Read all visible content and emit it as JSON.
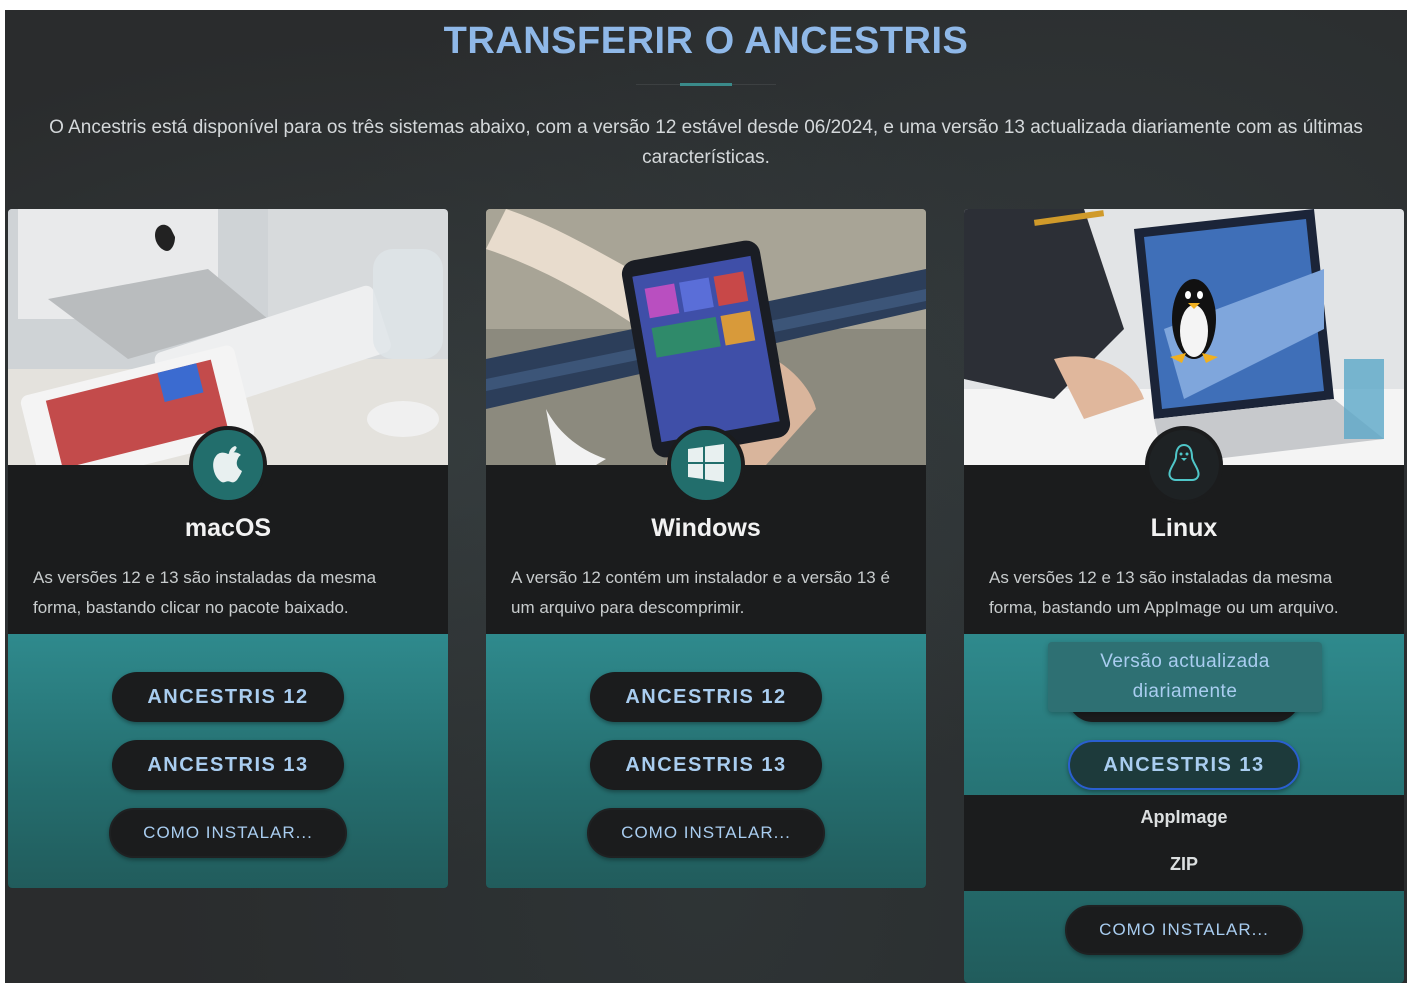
{
  "header": {
    "title": "TRANSFERIR O ANCESTRIS",
    "intro": "O Ancestris está disponível para os três sistemas abaixo, com a versão 12 estável desde 06/2024, e uma versão 13 actualizada diariamente com as últimas características."
  },
  "cards": [
    {
      "name": "macOS",
      "icon": "apple-icon",
      "description": "As versões 12 e 13 são instaladas da mesma forma, bastando clicar no pacote baixado.",
      "button_v12": "ANCESTRIS 12",
      "button_v13": "ANCESTRIS 13",
      "button_howto": "COMO INSTALAR..."
    },
    {
      "name": "Windows",
      "icon": "windows-icon",
      "description": "A versão 12 contém um instalador e a versão 13 é um arquivo para descomprimir.",
      "button_v12": "ANCESTRIS 12",
      "button_v13": "ANCESTRIS 13",
      "button_howto": "COMO INSTALAR..."
    },
    {
      "name": "Linux",
      "icon": "tux-icon",
      "description": "As versões 12 e 13 são instaladas da mesma forma, bastando um AppImage ou um arquivo.",
      "tooltip": "Versão actualizada diariamente",
      "button_v13": "ANCESTRIS 13",
      "dropdown": [
        "AppImage",
        "ZIP"
      ],
      "button_howto": "COMO INSTALAR..."
    }
  ],
  "colors": {
    "title": "#8fb8e8",
    "accent_teal": "#2f8a8d",
    "button_text": "#a9cdf0",
    "card_bg": "#1b1c1d",
    "focus_border": "#2a5fd0"
  }
}
